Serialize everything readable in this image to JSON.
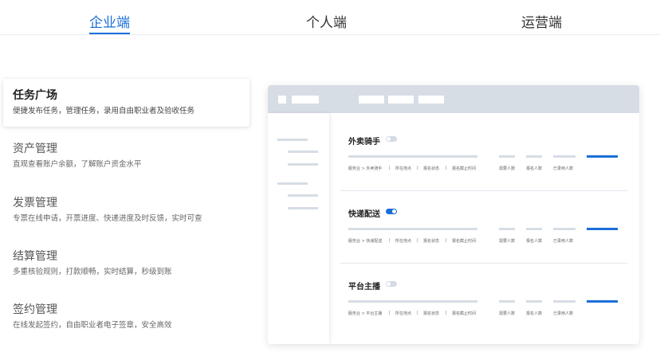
{
  "tabs": [
    {
      "label": "企业端",
      "active": true
    },
    {
      "label": "个人端",
      "active": false
    },
    {
      "label": "运营端",
      "active": false
    }
  ],
  "features": [
    {
      "title": "任务广场",
      "desc": "便捷发布任务，管理任务，录用自由职业者及验收任务",
      "active": true
    },
    {
      "title": "资产管理",
      "desc": "直观查看账户余额，了解账户资金水平",
      "active": false
    },
    {
      "title": "发票管理",
      "desc": "专票在线申请，开票进度、快递进度及时反馈，实时可查",
      "active": false
    },
    {
      "title": "结算管理",
      "desc": "多重核验规则，打款顺畅，实时结算，秒级到账",
      "active": false
    },
    {
      "title": "签约管理",
      "desc": "在线发起签约，自由职业者电子签章，安全高效",
      "active": false
    }
  ],
  "mockup": {
    "cards": [
      {
        "title": "外卖骑手",
        "toggle_on": false,
        "meta": [
          "服务业 > 外卖骑手",
          "|",
          "所在地点",
          "|",
          "报名状态",
          "|",
          "报名截止时间",
          "需要人数",
          "报名人数",
          "已录用人数"
        ]
      },
      {
        "title": "快递配送",
        "toggle_on": true,
        "meta": [
          "服务业 > 快递配送",
          "|",
          "所在地点",
          "|",
          "报名状态",
          "|",
          "报名截止时间",
          "需要人数",
          "报名人数",
          "已录用人数"
        ]
      },
      {
        "title": "平台主播",
        "toggle_on": false,
        "meta": [
          "服务业 > 平台主播",
          "|",
          "所在地点",
          "|",
          "报名状态",
          "|",
          "报名截止时间",
          "需要人数",
          "报名人数",
          "已录用人数"
        ]
      }
    ]
  },
  "colors": {
    "accent": "#1a6ed8",
    "placeholder": "#d7dde5"
  }
}
